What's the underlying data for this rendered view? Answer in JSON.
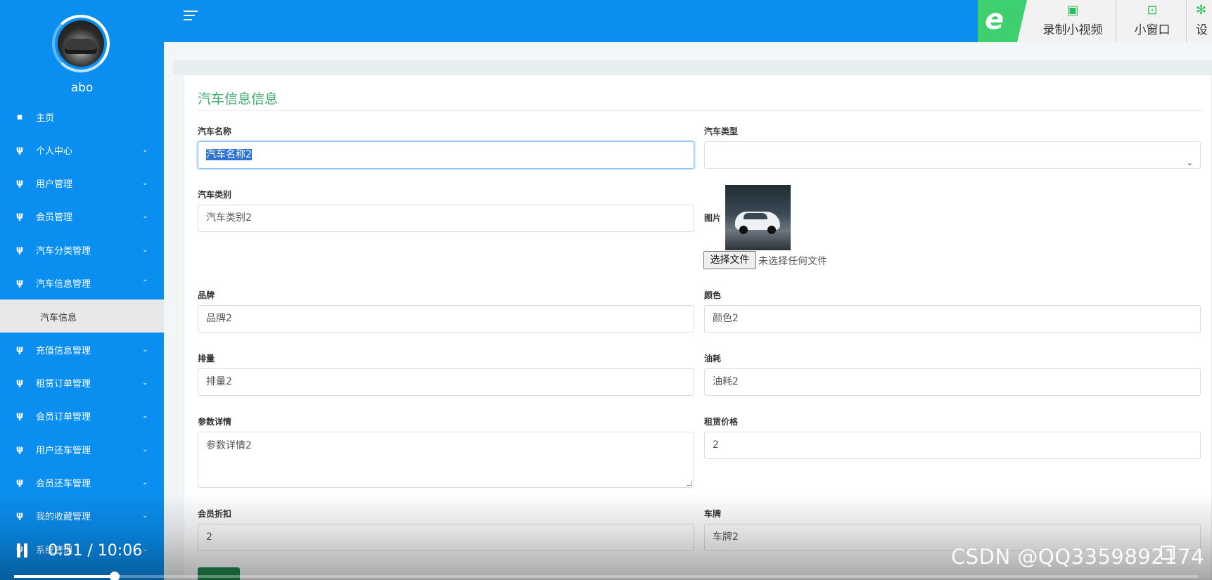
{
  "sidebar": {
    "username": "abo",
    "menu": [
      {
        "label": "主页",
        "icon": "dashboard-icon",
        "chevron": ""
      },
      {
        "label": "个人中心",
        "icon": "menu-icon",
        "chevron": "⌄"
      },
      {
        "label": "用户管理",
        "icon": "menu-icon",
        "chevron": "⌄"
      },
      {
        "label": "会员管理",
        "icon": "menu-icon",
        "chevron": "⌄"
      },
      {
        "label": "汽车分类管理",
        "icon": "menu-icon",
        "chevron": "⌄"
      },
      {
        "label": "汽车信息管理",
        "icon": "menu-icon",
        "chevron": "⌃"
      },
      {
        "label": "充值信息管理",
        "icon": "menu-icon",
        "chevron": "⌄"
      },
      {
        "label": "租赁订单管理",
        "icon": "menu-icon",
        "chevron": "⌄"
      },
      {
        "label": "会员订单管理",
        "icon": "menu-icon",
        "chevron": "⌄"
      },
      {
        "label": "用户还车管理",
        "icon": "menu-icon",
        "chevron": "⌄"
      },
      {
        "label": "会员还车管理",
        "icon": "menu-icon",
        "chevron": "⌄"
      },
      {
        "label": "我的收藏管理",
        "icon": "menu-icon",
        "chevron": "⌄"
      },
      {
        "label": "系统管理",
        "icon": "menu-icon",
        "chevron": "⌄"
      }
    ],
    "submenu_active": "汽车信息"
  },
  "recorder": {
    "logo": "e",
    "record_label": "录制小视频",
    "window_label": "小窗口",
    "settings_label": "设"
  },
  "form": {
    "title": "汽车信息信息",
    "car_name": {
      "label": "汽车名称",
      "value": "汽车名称2"
    },
    "car_type": {
      "label": "汽车类型",
      "value": ""
    },
    "car_category": {
      "label": "汽车类别",
      "value": "汽车类别2"
    },
    "picture": {
      "label": "图片",
      "file_button": "选择文件",
      "file_status": "未选择任何文件"
    },
    "brand": {
      "label": "品牌",
      "value": "品牌2"
    },
    "color": {
      "label": "颜色",
      "value": "颜色2"
    },
    "displacement": {
      "label": "排量",
      "value": "排量2"
    },
    "fuel": {
      "label": "油耗",
      "value": "油耗2"
    },
    "params": {
      "label": "参数详情",
      "value": "参数详情2"
    },
    "rent_price": {
      "label": "租赁价格",
      "value": "2"
    },
    "member_discount": {
      "label": "会员折扣",
      "value": "2"
    },
    "plate": {
      "label": "车牌",
      "value": "车牌2"
    }
  },
  "video": {
    "time": "0:51 / 10:06",
    "progress": 0.085,
    "watermark": "CSDN @QQ3359892174"
  },
  "colors": {
    "primary": "#0a8ff0",
    "title_green": "#3cab6d",
    "recorder_green": "#3ecf6e"
  }
}
